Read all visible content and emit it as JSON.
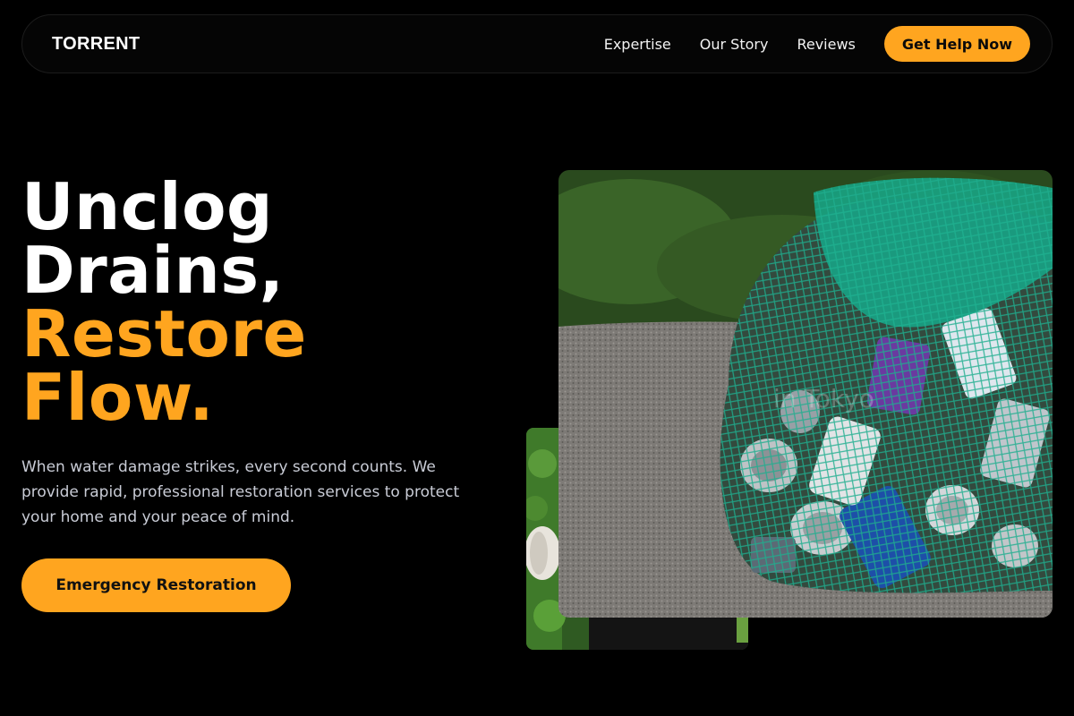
{
  "nav": {
    "brand": "TORRENT",
    "links": [
      "Expertise",
      "Our Story",
      "Reviews"
    ],
    "cta": "Get Help Now"
  },
  "hero": {
    "title_line1": "Unclog",
    "title_line2": "Drains,",
    "title_line3": "Restore",
    "title_line4": "Flow.",
    "description": "When water damage strikes, every second counts. We provide rapid, professional restoration services to protect your home and your peace of mind.",
    "cta": "Emergency Restoration"
  },
  "images": {
    "main_watermark": "in Tokyo"
  },
  "colors": {
    "accent": "#ffa51f",
    "background": "#000000",
    "text_muted": "#c9ccd6"
  }
}
